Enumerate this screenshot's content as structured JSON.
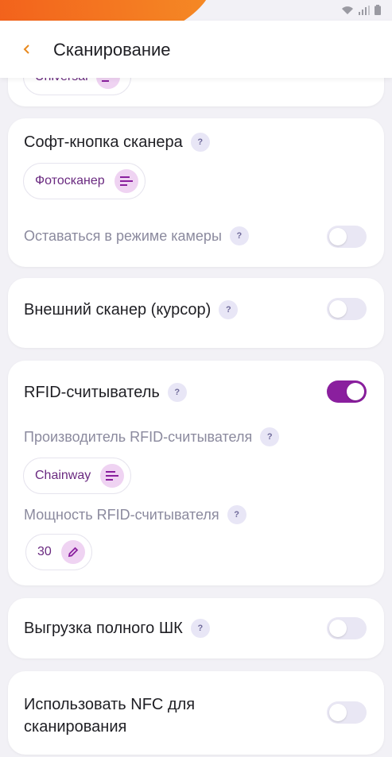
{
  "header": {
    "title": "Сканирование"
  },
  "partial_card": {
    "chip_label": "Universal"
  },
  "soft_button_card": {
    "title": "Софт-кнопка сканера",
    "chip_label": "Фотосканер",
    "stay_camera_label": "Оставаться в режиме камеры",
    "stay_camera_on": false
  },
  "external_scanner_card": {
    "title": "Внешний сканер (курсор)",
    "on": false
  },
  "rfid_card": {
    "title": "RFID-считыватель",
    "on": true,
    "maker_label": "Производитель RFID-считывателя",
    "maker_value": "Chainway",
    "power_label": "Мощность RFID-считывателя",
    "power_value": "30"
  },
  "full_barcode_card": {
    "title": "Выгрузка полного ШК",
    "on": false
  },
  "nfc_card": {
    "title_line1": "Использовать NFC для",
    "title_line2": "сканирования",
    "on": false
  },
  "help_glyph": "?",
  "colors": {
    "accent": "#8a1f9e",
    "chip_icon_bg": "#efd3f2",
    "orange": "#f25a1a"
  }
}
